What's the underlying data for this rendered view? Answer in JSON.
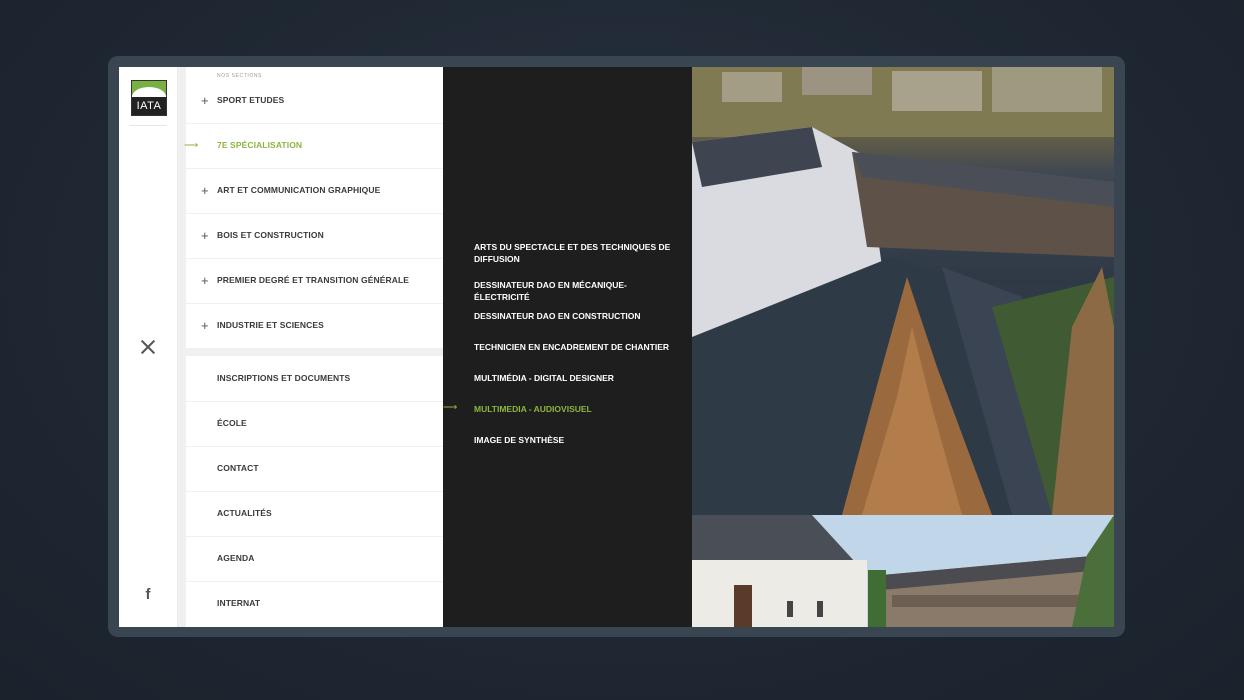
{
  "logo": {
    "text": "IATA"
  },
  "menu": {
    "header": "NOS SECTIONS",
    "sections": [
      {
        "label": "SPORT ETUDES",
        "icon": "plus-icon",
        "active": false
      },
      {
        "label": "7E SPÉCIALISATION",
        "icon": "arrow-right-icon",
        "active": true
      },
      {
        "label": "ART ET COMMUNICATION GRAPHIQUE",
        "icon": "plus-icon",
        "active": false
      },
      {
        "label": "BOIS ET CONSTRUCTION",
        "icon": "plus-icon",
        "active": false
      },
      {
        "label": "PREMIER DEGRÉ ET TRANSITION GÉNÉRALE",
        "icon": "plus-icon",
        "active": false
      },
      {
        "label": "INDUSTRIE ET SCIENCES",
        "icon": "plus-icon",
        "active": false
      }
    ],
    "links": [
      {
        "label": "INSCRIPTIONS ET DOCUMENTS"
      },
      {
        "label": "ÉCOLE"
      },
      {
        "label": "CONTACT"
      },
      {
        "label": "ACTUALITÉS"
      },
      {
        "label": "AGENDA"
      },
      {
        "label": "INTERNAT"
      }
    ]
  },
  "submenu": {
    "items": [
      {
        "label": "ARTS DU SPECTACLE ET DES TECHNIQUES DE DIFFUSION",
        "active": false
      },
      {
        "label": "DESSINATEUR DAO EN MÉCANIQUE-ÉLECTRICITÉ",
        "active": false
      },
      {
        "label": "DESSINATEUR DAO EN CONSTRUCTION",
        "active": false
      },
      {
        "label": "TECHNICIEN EN ENCADREMENT DE CHANTIER",
        "active": false
      },
      {
        "label": "MULTIMÉDIA - DIGITAL DESIGNER",
        "active": false
      },
      {
        "label": "MULTIMEDIA - AUDIOVISUEL",
        "active": true
      },
      {
        "label": "IMAGE DE SYNTHÈSE",
        "active": false
      }
    ]
  },
  "colors": {
    "accent": "#8cb63c",
    "dark_panel": "#1e1e1e",
    "background": "#1f2833"
  },
  "icons": {
    "close": "close-icon",
    "facebook": "facebook-icon"
  }
}
